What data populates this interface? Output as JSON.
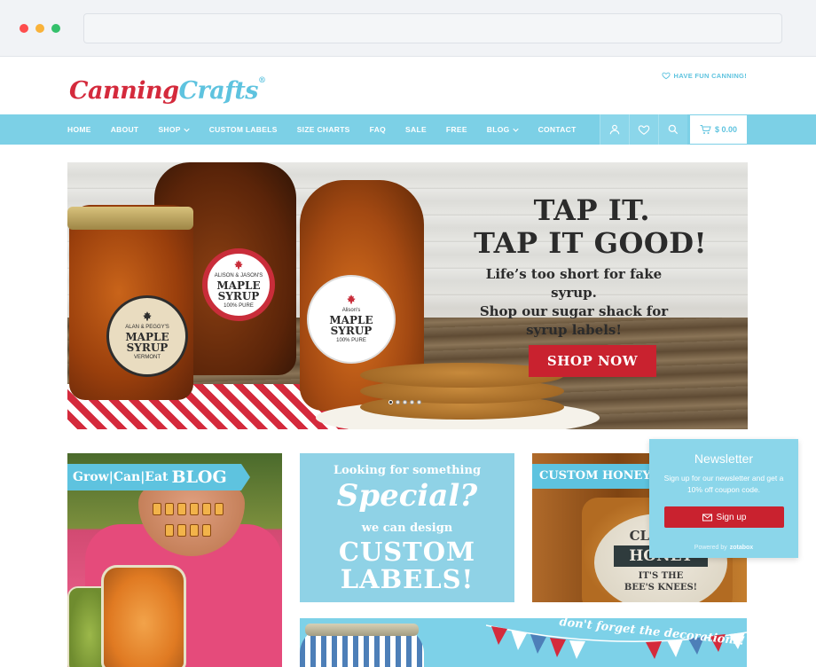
{
  "browser": {
    "address": ""
  },
  "header": {
    "logo_part1": "Canning",
    "logo_part2": "Crafts",
    "logo_reg": "®",
    "tagline": "HAVE FUN CANNING!"
  },
  "nav": {
    "items": [
      {
        "label": "HOME",
        "has_dropdown": false
      },
      {
        "label": "ABOUT",
        "has_dropdown": false
      },
      {
        "label": "SHOP",
        "has_dropdown": true
      },
      {
        "label": "CUSTOM LABELS",
        "has_dropdown": false
      },
      {
        "label": "SIZE CHARTS",
        "has_dropdown": false
      },
      {
        "label": "FAQ",
        "has_dropdown": false
      },
      {
        "label": "SALE",
        "has_dropdown": false
      },
      {
        "label": "FREE",
        "has_dropdown": false
      },
      {
        "label": "BLOG",
        "has_dropdown": true
      },
      {
        "label": "CONTACT",
        "has_dropdown": false
      }
    ],
    "icons": [
      "user-icon",
      "heart-icon",
      "search-icon"
    ],
    "cart_total": "$ 0.00"
  },
  "hero": {
    "headline_1": "TAP IT.",
    "headline_2": "TAP IT GOOD!",
    "sub_1": "Life’s too short for fake syrup.",
    "sub_2": "Shop our sugar shack for",
    "sub_3": "syrup labels!",
    "cta": "SHOP NOW",
    "slide_count": 5,
    "active_slide": 1,
    "label_a_small_top": "ALAN & PEGGY'S",
    "label_a_big": "MAPLE SYRUP",
    "label_a_small_bottom": "VERMONT",
    "label_b_small_top": "ALISON & JASON'S",
    "label_b_big": "MAPLE SYRUP",
    "label_b_small_bottom": "100% PURE",
    "label_c_small_top": "Alison's",
    "label_c_big": "MAPLE SYRUP",
    "label_c_small_bottom": "100% PURE"
  },
  "tiles": {
    "blog_banner_prefix": "Grow|Can|Eat",
    "blog_banner_word": "BLOG",
    "special_line1": "Looking for something",
    "special_line2": "Special?",
    "special_line3": "we can design",
    "special_line4": "CUSTOM",
    "special_line5": "LABELS!",
    "honey_banner": "CUSTOM HONEY",
    "honey_label_1": "CLOVER",
    "honey_label_2": "HONEY",
    "honey_label_3": "IT'S THE",
    "honey_label_4": "BEE'S KNEES!",
    "decor_text": "don't forget the decorations!"
  },
  "newsletter": {
    "title": "Newsletter",
    "text": "Sign up for our newsletter and get a 10% off coupon code.",
    "button": "Sign up",
    "powered_prefix": "Powered by",
    "powered_brand": "zotabox"
  },
  "colors": {
    "accent": "#7cd0e6",
    "brand_red": "#c9222f",
    "logo_red": "#d42a3c",
    "logo_blue": "#5ec3df"
  }
}
